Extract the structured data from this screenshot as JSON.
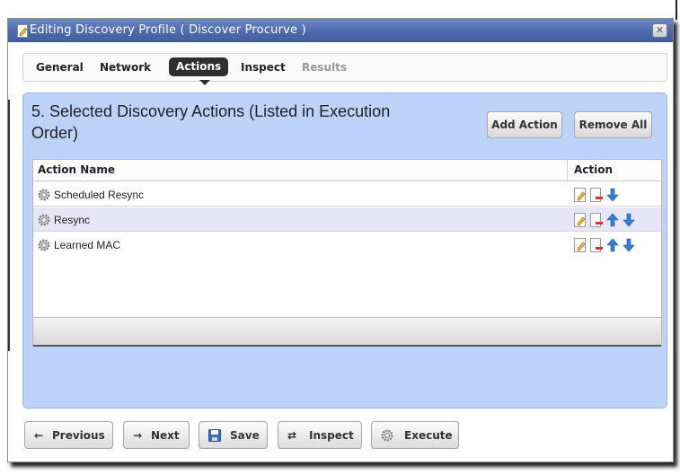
{
  "dialog": {
    "title": "Editing Discovery Profile ( Discover Procurve )",
    "close_label": "✕"
  },
  "tabs": [
    {
      "label": "General",
      "state": "normal"
    },
    {
      "label": "Network",
      "state": "normal"
    },
    {
      "label": "Actions",
      "state": "active"
    },
    {
      "label": "Inspect",
      "state": "normal"
    },
    {
      "label": "Results",
      "state": "disabled"
    }
  ],
  "panel": {
    "heading": "5. Selected Discovery Actions (Listed in Execution Order)",
    "add_action_label": "Add Action",
    "remove_all_label": "Remove All"
  },
  "grid": {
    "columns": [
      "Action Name",
      "Action"
    ],
    "rows": [
      {
        "name": "Scheduled Resync",
        "actions": [
          "edit-icon",
          "delete-icon",
          "move-down-icon"
        ]
      },
      {
        "name": "Resync",
        "actions": [
          "edit-icon",
          "delete-icon",
          "move-up-icon",
          "move-down-icon"
        ]
      },
      {
        "name": "Learned MAC",
        "actions": [
          "edit-icon",
          "delete-icon",
          "move-up-icon",
          "move-down-icon"
        ]
      }
    ]
  },
  "footer": {
    "previous_label": "Previous",
    "next_label": "Next",
    "save_label": "Save",
    "inspect_label": "Inspect",
    "execute_label": "Execute"
  },
  "colors": {
    "titlebar": "#4d6aae",
    "panel_bg": "#bcd2f8",
    "active_tab": "#2e2e2e",
    "alt_row": "#e6e6f7",
    "arrow_blue": "#2f7fd6"
  }
}
